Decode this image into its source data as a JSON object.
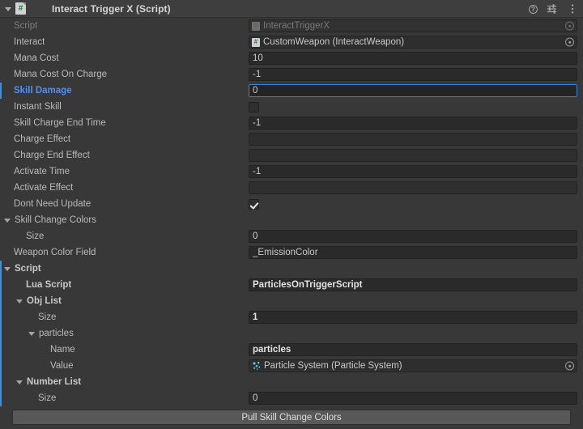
{
  "header": {
    "title": "Interact Trigger X (Script)",
    "foldout_icon": "chevron-down-icon",
    "script_icon_glyph": "#",
    "help_label": "?",
    "icons": [
      "help-icon",
      "preset-icon",
      "more-menu-icon"
    ]
  },
  "rows": [
    {
      "label": "Script",
      "indent": 0,
      "style": "dim",
      "field": {
        "type": "object",
        "value": "InteractTriggerX",
        "icon": "cs-script-icon",
        "disabled": true,
        "selector": true
      }
    },
    {
      "label": "Interact",
      "indent": 0,
      "style": "normal",
      "field": {
        "type": "object",
        "value": "CustomWeapon (InteractWeapon)",
        "icon": "cs-script-icon",
        "disabled": false,
        "selector": true
      }
    },
    {
      "label": "Mana Cost",
      "indent": 0,
      "style": "normal",
      "field": {
        "type": "text",
        "value": "10"
      }
    },
    {
      "label": "Mana Cost On Charge",
      "indent": 0,
      "style": "normal",
      "field": {
        "type": "text",
        "value": "-1"
      }
    },
    {
      "label": "Skill Damage",
      "indent": 0,
      "style": "modified",
      "field": {
        "type": "text",
        "value": "0",
        "focused": true
      }
    },
    {
      "label": "Instant Skill",
      "indent": 0,
      "style": "normal",
      "field": {
        "type": "checkbox",
        "checked": false
      }
    },
    {
      "label": "Skill Charge End Time",
      "indent": 0,
      "style": "normal",
      "field": {
        "type": "text",
        "value": "-1"
      }
    },
    {
      "label": "Charge Effect",
      "indent": 0,
      "style": "normal",
      "field": {
        "type": "object",
        "value": "",
        "icon": "",
        "selector": false
      }
    },
    {
      "label": "Charge End Effect",
      "indent": 0,
      "style": "normal",
      "field": {
        "type": "object",
        "value": "",
        "icon": "",
        "selector": false
      }
    },
    {
      "label": "Activate Time",
      "indent": 0,
      "style": "normal",
      "field": {
        "type": "text",
        "value": "-1"
      }
    },
    {
      "label": "Activate Effect",
      "indent": 0,
      "style": "normal",
      "field": {
        "type": "object",
        "value": "",
        "icon": "",
        "selector": false
      }
    },
    {
      "label": "Dont Need Update",
      "indent": 0,
      "style": "normal",
      "field": {
        "type": "checkbox",
        "checked": true
      }
    },
    {
      "label": "Skill Change Colors",
      "indent": 0,
      "style": "normal",
      "foldout": true,
      "field": {
        "type": "none"
      }
    },
    {
      "label": "Size",
      "indent": 1,
      "style": "normal",
      "field": {
        "type": "text",
        "value": "0"
      }
    },
    {
      "label": "Weapon Color Field",
      "indent": 0,
      "style": "normal",
      "field": {
        "type": "text",
        "value": "_EmissionColor"
      }
    },
    {
      "label": "Script",
      "indent": 0,
      "style": "ovr",
      "foldout": true,
      "field": {
        "type": "none"
      }
    },
    {
      "label": "Lua Script",
      "indent": 1,
      "style": "ovr",
      "field": {
        "type": "text",
        "value": "ParticlesOnTriggerScript",
        "bold": true
      }
    },
    {
      "label": "Obj List",
      "indent": 1,
      "style": "ovr",
      "foldout": true,
      "field": {
        "type": "none"
      }
    },
    {
      "label": "Size",
      "indent": 2,
      "style": "normal",
      "field": {
        "type": "text",
        "value": "1",
        "bold": true
      }
    },
    {
      "label": "particles",
      "indent": 2,
      "style": "normal",
      "foldout": true,
      "field": {
        "type": "none"
      }
    },
    {
      "label": "Name",
      "indent": 3,
      "style": "normal",
      "field": {
        "type": "text",
        "value": "particles",
        "bold": true
      }
    },
    {
      "label": "Value",
      "indent": 3,
      "style": "normal",
      "field": {
        "type": "object",
        "value": "Particle System (Particle System)",
        "icon": "particle-system-icon",
        "selector": true
      }
    },
    {
      "label": "Number List",
      "indent": 1,
      "style": "ovr",
      "foldout": true,
      "field": {
        "type": "none"
      }
    },
    {
      "label": "Size",
      "indent": 2,
      "style": "normal",
      "field": {
        "type": "text",
        "value": "0"
      }
    }
  ],
  "bottom": {
    "pull_button_label": "Pull Skill Change Colors"
  },
  "colors": {
    "background": "#383838",
    "header_bg": "#3e3e3e",
    "field_bg": "#2a2a2a",
    "accent_blue": "#4f8ff7",
    "override_bar": "#3e8fd8",
    "label_text": "#b9b9b9",
    "dim_text": "#7d7d7d",
    "button_bg": "#585858"
  }
}
